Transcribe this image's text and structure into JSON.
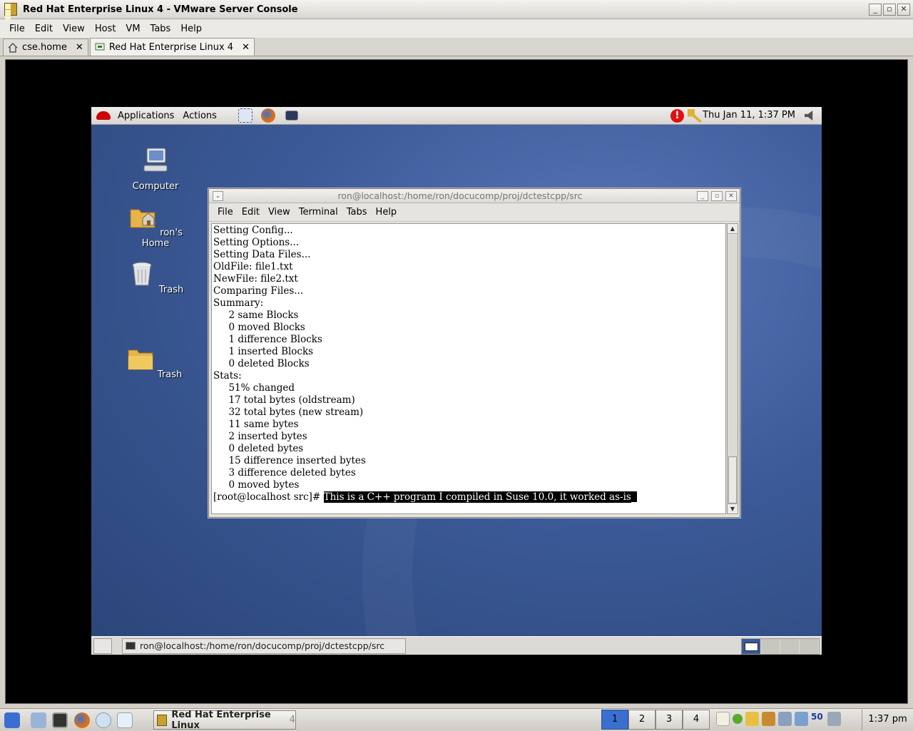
{
  "window": {
    "title": "Red Hat Enterprise Linux 4 - VMware Server Console"
  },
  "menubar": [
    "File",
    "Edit",
    "View",
    "Host",
    "VM",
    "Tabs",
    "Help"
  ],
  "tabs": [
    {
      "label": "cse.home",
      "close": "✕"
    },
    {
      "label": "Red Hat Enterprise Linux 4",
      "close": "✕"
    }
  ],
  "guest": {
    "panel": {
      "applications": "Applications",
      "actions": "Actions",
      "clock": "Thu Jan 11,  1:37 PM",
      "alert_glyph": "!"
    },
    "desktop_icons": [
      {
        "label": "Computer",
        "icon": "computer-icon"
      },
      {
        "label": "ron's Home",
        "icon": "home-folder-icon"
      },
      {
        "label": "Trash",
        "icon": "trash-icon"
      },
      {
        "label": "Trash",
        "icon": "folder-icon"
      }
    ],
    "bottom_panel": {
      "task_label": "ron@localhost:/home/ron/docucomp/proj/dctestcpp/src"
    }
  },
  "terminal": {
    "title": "ron@localhost:/home/ron/docucomp/proj/dctestcpp/src",
    "menu": [
      "File",
      "Edit",
      "View",
      "Terminal",
      "Tabs",
      "Help"
    ],
    "lines": [
      "Setting Config...",
      "Setting Options...",
      "Setting Data Files...",
      "OldFile: file1.txt",
      "NewFile: file2.txt",
      "Comparing Files...",
      "Summary:",
      "     2 same Blocks",
      "     0 moved Blocks",
      "     1 difference Blocks",
      "     1 inserted Blocks",
      "     0 deleted Blocks",
      "Stats:",
      "     51% changed",
      "     17 total bytes (oldstream)",
      "     32 total bytes (new stream)",
      "     11 same bytes",
      "     2 inserted bytes",
      "     0 deleted bytes",
      "     15 difference inserted bytes",
      "     3 difference deleted bytes",
      "     0 moved bytes"
    ],
    "prompt": "[root@localhost src]# ",
    "selected_text": "This is a C++ program I compiled in Suse 10.0, it worked as-is"
  },
  "host_taskbar": {
    "task_label": "Red Hat Enterprise Linux",
    "task_suffix": "4",
    "workspaces": [
      "1",
      "2",
      "3",
      "4"
    ],
    "active_workspace": "1",
    "tray_badge": "50",
    "clock": "1:37 pm"
  }
}
